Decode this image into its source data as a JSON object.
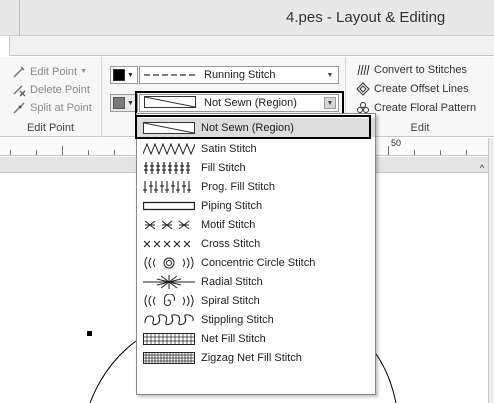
{
  "window": {
    "title": "4.pes - Layout & Editing"
  },
  "ribbon": {
    "edit_point_group": {
      "label": "Edit Point",
      "buttons": [
        {
          "label": "Edit Point",
          "has_menu": true
        },
        {
          "label": "Delete Point"
        },
        {
          "label": "Split at Point"
        }
      ]
    },
    "stitch_group": {
      "line_combo": {
        "label": "Running Stitch",
        "pattern": "dashed-line"
      },
      "region_combo": {
        "label": "Not Sewn (Region)"
      },
      "line_color": "#000000",
      "region_color": "#7a7a7a"
    },
    "edit_group": {
      "label": "Edit",
      "buttons": [
        {
          "label": "Convert to Stitches"
        },
        {
          "label": "Create Offset Lines"
        },
        {
          "label": "Create Floral Pattern"
        }
      ]
    }
  },
  "ruler": {
    "labels": [
      "50"
    ]
  },
  "dropdown": {
    "selected": "Not Sewn (Region)",
    "items": [
      {
        "label": "Not Sewn (Region)",
        "icon": "not-sewn-pattern"
      },
      {
        "label": "Satin Stitch",
        "icon": "satin-pattern",
        "glyph": "ΛΛΛΛΛΛΛ"
      },
      {
        "label": "Fill Stitch",
        "icon": "fill-pattern",
        "glyph": "‡‡‡‡‡‡‡‡"
      },
      {
        "label": "Prog. Fill Stitch",
        "icon": "prog-fill-pattern",
        "glyph": "‡|‡|‡|‡|‡"
      },
      {
        "label": "Piping Stitch",
        "icon": "piping-pattern"
      },
      {
        "label": "Motif Stitch",
        "icon": "motif-pattern",
        "glyph": "⌘⌘⌘"
      },
      {
        "label": "Cross Stitch",
        "icon": "cross-pattern",
        "glyph": "xxxxx"
      },
      {
        "label": "Concentric Circle Stitch",
        "icon": "concentric-pattern",
        "glyph": "((((◎))))"
      },
      {
        "label": "Radial Stitch",
        "icon": "radial-pattern",
        "glyph": "—✳—"
      },
      {
        "label": "Spiral Stitch",
        "icon": "spiral-pattern",
        "glyph": "(((◎)))"
      },
      {
        "label": "Stippling Stitch",
        "icon": "stippling-pattern",
        "glyph": "ᔕᔕᔕ"
      },
      {
        "label": "Net Fill Stitch",
        "icon": "net-fill-pattern"
      },
      {
        "label": "Zigzag Net Fill Stitch",
        "icon": "zigzag-net-pattern"
      }
    ]
  }
}
